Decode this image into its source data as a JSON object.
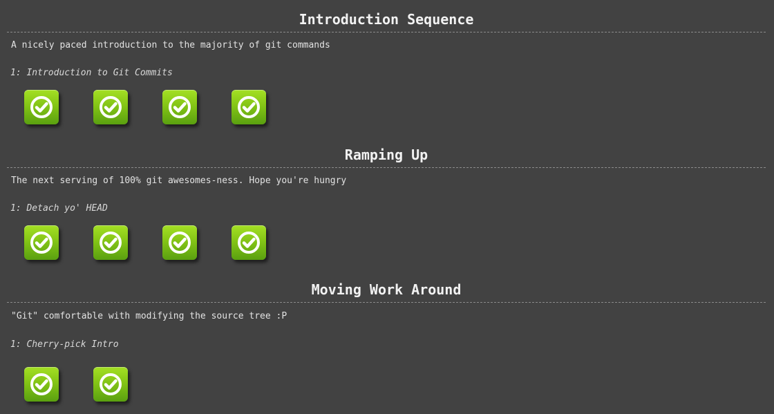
{
  "sequences": [
    {
      "title": "Introduction Sequence",
      "about": "A nicely paced introduction to the majority of git commands",
      "level_label": "1: Introduction to Git Commits",
      "levels": [
        {
          "status": "complete",
          "icon": "check-circle-icon"
        },
        {
          "status": "complete",
          "icon": "check-circle-icon"
        },
        {
          "status": "complete",
          "icon": "check-circle-icon"
        },
        {
          "status": "complete",
          "icon": "check-circle-icon"
        }
      ]
    },
    {
      "title": "Ramping Up",
      "about": "The next serving of 100% git awesomes-ness. Hope you're hungry",
      "level_label": "1: Detach yo' HEAD",
      "levels": [
        {
          "status": "complete",
          "icon": "check-circle-icon"
        },
        {
          "status": "complete",
          "icon": "check-circle-icon"
        },
        {
          "status": "complete",
          "icon": "check-circle-icon"
        },
        {
          "status": "complete",
          "icon": "check-circle-icon"
        }
      ]
    },
    {
      "title": "Moving Work Around",
      "about": "\"Git\" comfortable with modifying the source tree :P",
      "level_label": "1: Cherry-pick Intro",
      "levels": [
        {
          "status": "complete",
          "icon": "check-circle-icon"
        },
        {
          "status": "complete",
          "icon": "check-circle-icon"
        }
      ]
    }
  ],
  "colors": {
    "background": "#424242",
    "complete_green": "#84c516",
    "check_white": "#ffffff"
  }
}
